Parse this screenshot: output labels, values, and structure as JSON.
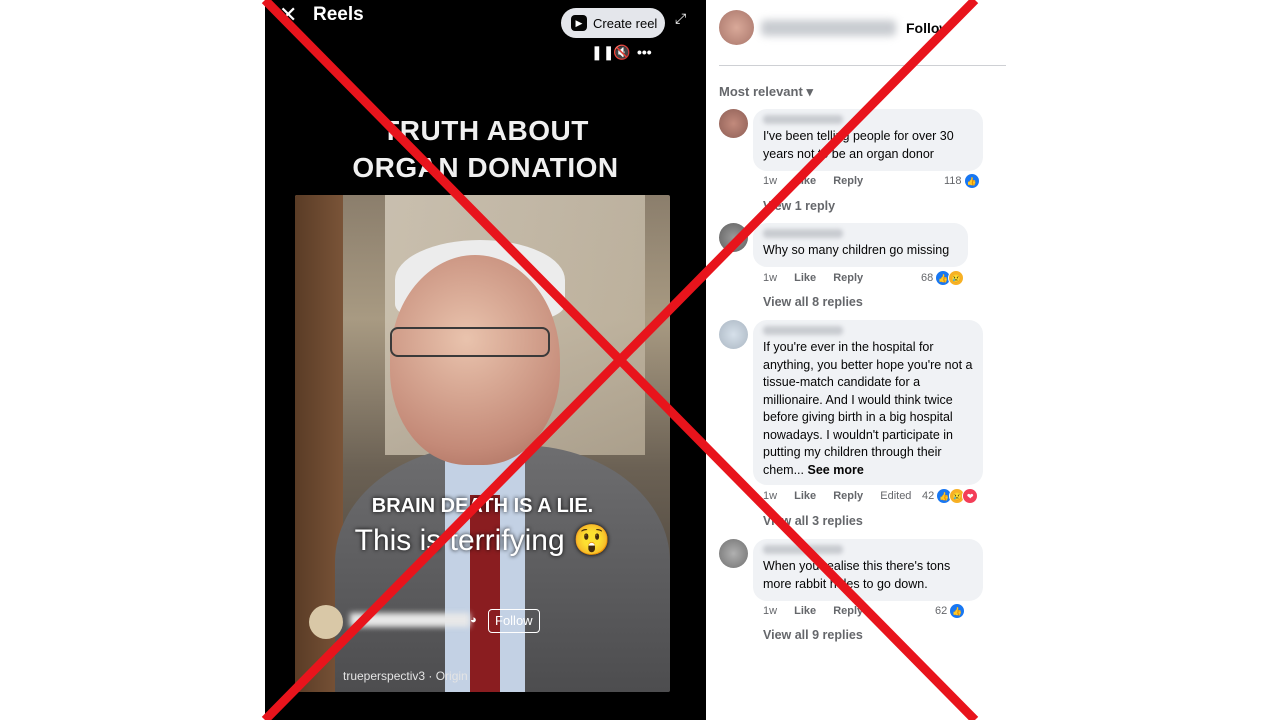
{
  "reel": {
    "title": "Reels",
    "close_icon": "close-icon",
    "create_reel_label": "Create reel",
    "video_title": "TRUTH ABOUT ORGAN DONATION",
    "caption_line1": "BRAIN DEATH IS A LIE.",
    "caption_line2": "This is terrifying 😲",
    "follow_label": "Follow",
    "audio_label": "trueperspectiv3 · Origin"
  },
  "comments_panel": {
    "follow_label": "Follow",
    "sort_label": "Most relevant",
    "comments": [
      {
        "text": "I've been telling people for over 30 years not to be an organ donor",
        "time": "1w",
        "like_label": "Like",
        "reply_label": "Reply",
        "reaction_count": "118",
        "replies_label": "View 1 reply"
      },
      {
        "text": "Why so many children go missing",
        "time": "1w",
        "like_label": "Like",
        "reply_label": "Reply",
        "reaction_count": "68",
        "replies_label": "View all 8 replies"
      },
      {
        "text": "If you're ever in the hospital for anything, you better hope you're not a tissue-match candidate for a millionaire. And I would think twice before giving birth in a big hospital nowadays. I wouldn't participate in putting my children through their chem...",
        "see_more": "See more",
        "time": "1w",
        "like_label": "Like",
        "reply_label": "Reply",
        "edited_label": "Edited",
        "reaction_count": "42",
        "replies_label": "View all 3 replies"
      },
      {
        "text": "When you realise this there's tons more rabbit holes to go down.",
        "time": "1w",
        "like_label": "Like",
        "reply_label": "Reply",
        "reaction_count": "62",
        "replies_label": "View all 9 replies"
      }
    ]
  },
  "overlay": {
    "mark_color": "#e8141c"
  },
  "colors": {
    "reel_bg": "#000000",
    "bubble_bg": "#f0f2f5",
    "like_blue": "#1877f2",
    "meta_gray": "#65676b"
  }
}
